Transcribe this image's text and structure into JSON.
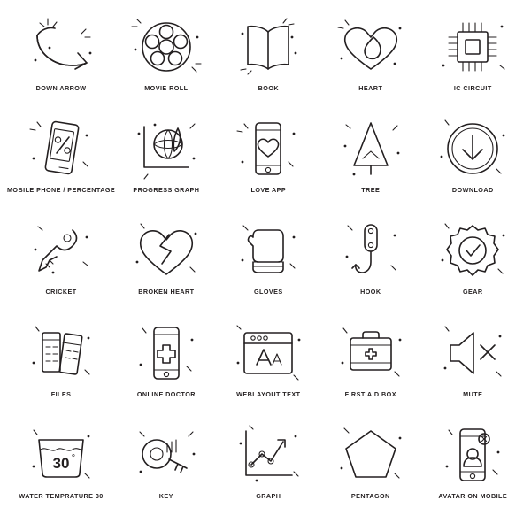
{
  "page": {
    "background": "#ffffff",
    "line_color": "#231f20",
    "label_color": "#231f20",
    "columns": 5,
    "rows": 5
  },
  "icons": [
    {
      "label": "Down Arrow",
      "icon_name": "down-arrow-icon"
    },
    {
      "label": "Movie Roll",
      "icon_name": "movie-roll-icon"
    },
    {
      "label": "Book",
      "icon_name": "book-icon"
    },
    {
      "label": "Heart",
      "icon_name": "heart-icon"
    },
    {
      "label": "IC Circuit",
      "icon_name": "ic-circuit-icon"
    },
    {
      "label": "Mobile Phone / Percentage",
      "icon_name": "mobile-phone-percentage-icon"
    },
    {
      "label": "Progress Graph",
      "icon_name": "progress-graph-icon"
    },
    {
      "label": "Love App",
      "icon_name": "love-app-icon"
    },
    {
      "label": "Tree",
      "icon_name": "tree-icon"
    },
    {
      "label": "Download",
      "icon_name": "download-icon"
    },
    {
      "label": "Cricket",
      "icon_name": "cricket-icon"
    },
    {
      "label": "Broken Heart",
      "icon_name": "broken-heart-icon"
    },
    {
      "label": "Gloves",
      "icon_name": "gloves-icon"
    },
    {
      "label": "Hook",
      "icon_name": "hook-icon"
    },
    {
      "label": "Gear",
      "icon_name": "gear-icon"
    },
    {
      "label": "Files",
      "icon_name": "files-icon"
    },
    {
      "label": "Online Doctor",
      "icon_name": "online-doctor-icon"
    },
    {
      "label": "Weblayout Text",
      "icon_name": "weblayout-text-icon"
    },
    {
      "label": "First Aid Box",
      "icon_name": "first-aid-box-icon"
    },
    {
      "label": "Mute",
      "icon_name": "mute-icon"
    },
    {
      "label": "Water Temprature 30",
      "icon_name": "water-temperature-30-icon"
    },
    {
      "label": "Key",
      "icon_name": "key-icon"
    },
    {
      "label": "Graph",
      "icon_name": "graph-icon"
    },
    {
      "label": "Pentagon",
      "icon_name": "pentagon-icon"
    },
    {
      "label": "Avatar on Mobile",
      "icon_name": "avatar-on-mobile-icon"
    }
  ],
  "glyph_text": {
    "weblayout_text_big": "A",
    "weblayout_text_small": "A",
    "water_temperature_value": "30",
    "water_temperature_degree": "°",
    "percentage_symbol": "%"
  }
}
